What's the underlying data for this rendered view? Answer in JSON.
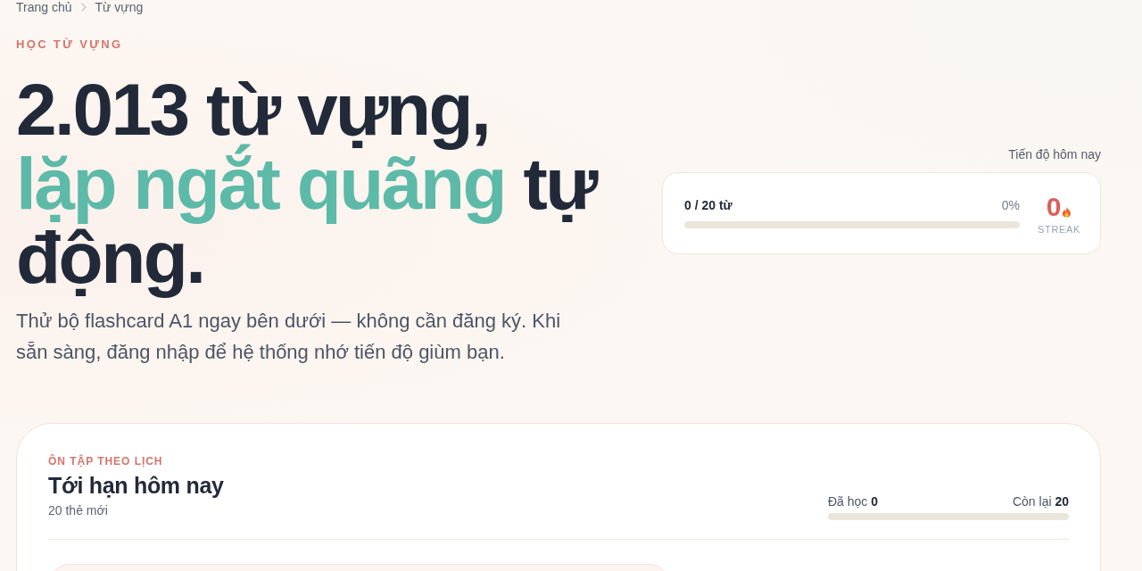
{
  "breadcrumb": [
    {
      "label": "Trang chủ"
    },
    {
      "label": "Từ vựng"
    }
  ],
  "hero": {
    "eyebrow": "HỌC TỪ VỰNG",
    "title_lead": "2.013 từ vựng,",
    "title_highlight": "lặp ngắt quãng",
    "title_tail": "tự động.",
    "description": "Thử bộ flashcard A1 ngay bên dưới — không cần đăng ký. Khi sẵn sàng, đăng nhập để hệ thống nhớ tiến độ giùm bạn."
  },
  "today_progress": {
    "label": "Tiến độ hôm nay",
    "count": "0 / 20 từ",
    "percent": "0%",
    "streak": "0",
    "streak_label": "STREAK"
  },
  "review": {
    "eyebrow": "ÔN TẬP THEO LỊCH",
    "title": "Tới hạn hôm nay",
    "subtitle": "20 thẻ mới",
    "learned": "Đã học **0**",
    "remaining": "Còn lại **20**"
  }
}
